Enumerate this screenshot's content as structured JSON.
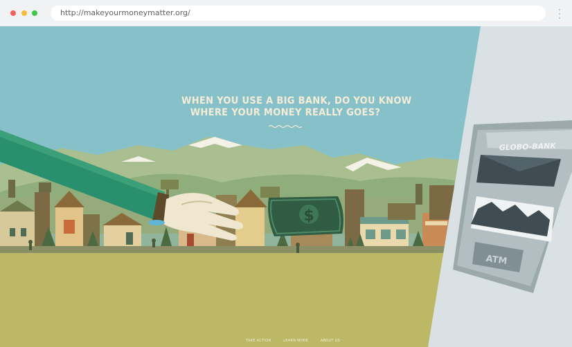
{
  "browser": {
    "url": "http://makeyourmoneymatter.org/"
  },
  "hero": {
    "headline_line1": "WHEN YOU USE A BIG BANK, DO YOU KNOW",
    "headline_line2": "WHERE YOUR MONEY REALLY GOES?"
  },
  "atm": {
    "brand": "GLOBO-BANK",
    "label": "ATM"
  },
  "bill": {
    "symbol": "$"
  },
  "footer": {
    "links": [
      "TAKE ACTION",
      "LEARN MORE",
      "ABOUT US"
    ],
    "separator": "·"
  },
  "colors": {
    "sky": "#86c0c8",
    "ground": "#bdb866",
    "sleeve": "#2a8f6c",
    "atm_body": "#d9e1e4",
    "bill": "#2f5c42"
  },
  "icons": [
    "red-dot-icon",
    "yellow-dot-icon",
    "green-dot-icon",
    "kebab-menu-icon",
    "dollar-sign-icon"
  ]
}
